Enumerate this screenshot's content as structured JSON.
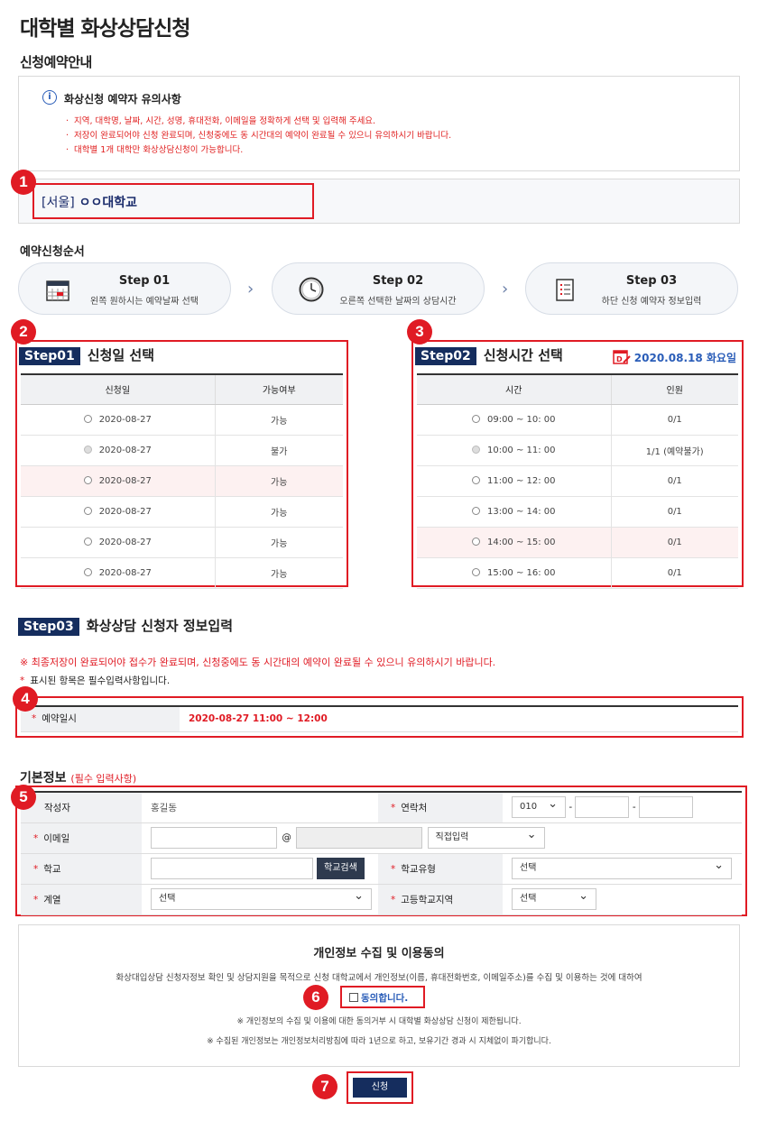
{
  "page_title": "대학별 화상상담신청",
  "guide_title": "신청예약안내",
  "notice": {
    "title": "화상신청 예약자 유의사항",
    "items": [
      "지역, 대학명, 날짜, 시간, 성명, 휴대전화, 이메일을 정확하게 선택 및 입력해 주세요.",
      "저장이 완료되어야 신청 완료되며, 신청중에도 동 시간대의 예약이 완료될 수 있으니 유의하시기 바랍니다.",
      "대학별 1개 대학만 화상상담신청이 가능합니다."
    ]
  },
  "university": {
    "region": "[서울]",
    "name": "ㅇㅇ대학교"
  },
  "badges": [
    "1",
    "2",
    "3",
    "4",
    "5",
    "6",
    "7"
  ],
  "order_title": "예약신청순서",
  "steps": [
    {
      "title": "Step 01",
      "desc": "왼쪽 원하시는 예약날짜 선택",
      "icon": "calendar-icon"
    },
    {
      "title": "Step 02",
      "desc": "오른쪽 선택한 날짜의 상담시간",
      "icon": "clock-icon"
    },
    {
      "title": "Step 03",
      "desc": "하단 신청 예약자 정보입력",
      "icon": "checklist-icon"
    }
  ],
  "step01": {
    "tag": "Step01",
    "title": "신청일 선택",
    "headers": [
      "신청일",
      "가능여부"
    ],
    "rows": [
      {
        "date": "2020-08-27",
        "status": "가능",
        "disabled": false
      },
      {
        "date": "2020-08-27",
        "status": "불가",
        "disabled": true
      },
      {
        "date": "2020-08-27",
        "status": "가능",
        "disabled": false
      },
      {
        "date": "2020-08-27",
        "status": "가능",
        "disabled": false
      },
      {
        "date": "2020-08-27",
        "status": "가능",
        "disabled": false
      },
      {
        "date": "2020-08-27",
        "status": "가능",
        "disabled": false
      }
    ]
  },
  "step02": {
    "tag": "Step02",
    "title": "신청시간 선택",
    "date": "2020.08.18 화요일",
    "headers": [
      "시간",
      "인원"
    ],
    "rows": [
      {
        "time": "09:00 ~ 10: 00",
        "count": "0/1",
        "disabled": false
      },
      {
        "time": "10:00 ~ 11: 00",
        "count": "1/1 (예약불가)",
        "disabled": true
      },
      {
        "time": "11:00 ~ 12: 00",
        "count": "0/1",
        "disabled": false
      },
      {
        "time": "13:00 ~ 14: 00",
        "count": "0/1",
        "disabled": false
      },
      {
        "time": "14:00 ~ 15: 00",
        "count": "0/1",
        "disabled": false
      },
      {
        "time": "15:00 ~ 16: 00",
        "count": "0/1",
        "disabled": false
      }
    ]
  },
  "step03": {
    "tag": "Step03",
    "title": "화상상담 신청자 정보입력",
    "warning": "※ 최종저장이 완료되어야 접수가 완료되며, 신청중에도 동 시간대의 예약이 완료될 수 있으니 유의하시기 바랍니다.",
    "required_note": "표시된 항목은 필수입력사항입니다.",
    "star": "*",
    "reservation_label": "예약일시",
    "reservation_value": "2020-08-27 11:00 ~ 12:00"
  },
  "basic": {
    "title": "기본정보",
    "subtitle": "(필수 입력사항)",
    "writer_label": "작성자",
    "writer_value": "홍길동",
    "contact_label": "연락처",
    "phone_prefix": "010",
    "email_label": "이메일",
    "at": "@",
    "dash": "-",
    "email_domain_select": "직접입력",
    "school_label": "학교",
    "school_search": "학교검색",
    "school_type_label": "학교유형",
    "school_type_value": "선택",
    "track_label": "계열",
    "track_value": "선택",
    "hs_region_label": "고등학교지역",
    "hs_region_value": "선택"
  },
  "consent": {
    "title": "개인정보 수집 및 이용동의",
    "desc": "화상대입상담 신청자정보 확인 및 상담지원을 목적으로 신청 대학교에서 개인정보(이름, 휴대전화번호, 이메일주소)를 수집 및 이용하는 것에 대하여",
    "agree_label": "동의합니다.",
    "note1": "※ 개인정보의 수집 및 이용에 대한 동의거부 시 대학별 화상상담 신청이 제한됩니다.",
    "note2": "※ 수집된 개인정보는 개인정보처리방침에 따라 1년으로 하고, 보유기간 경과 시 지체없이 파기합니다."
  },
  "submit_label": "신청"
}
